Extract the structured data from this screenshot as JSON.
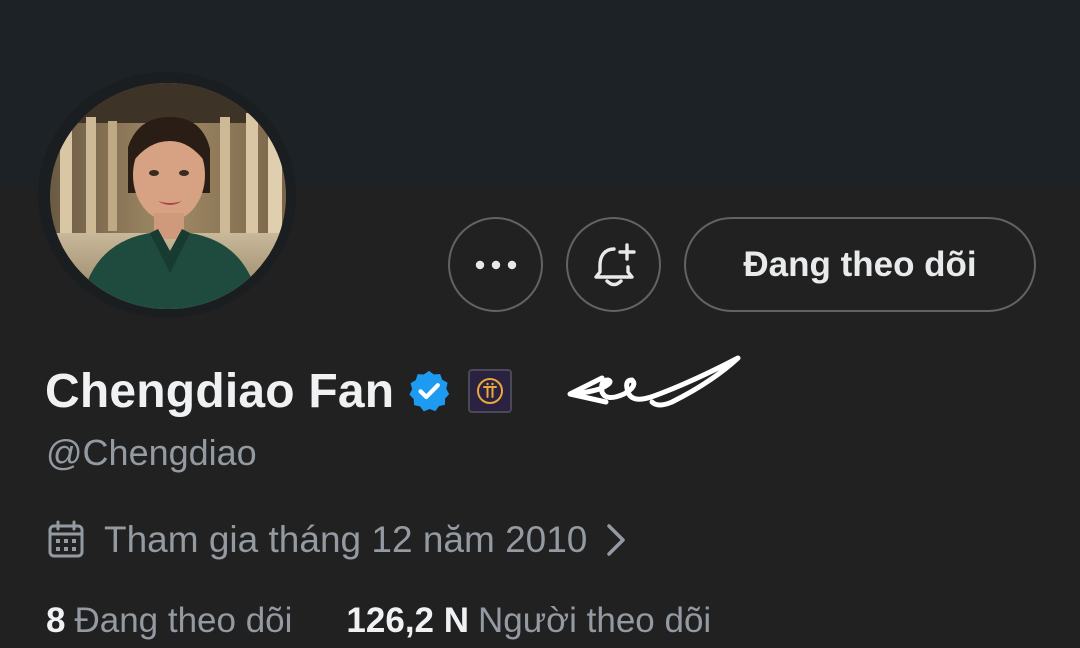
{
  "profile": {
    "display_name": "Chengdiao Fan",
    "handle": "@Chengdiao",
    "joined": "Tham gia tháng 12 năm 2010",
    "verified": true,
    "badge_icon": "pi-network-icon"
  },
  "actions": {
    "more_icon": "more-horizontal-icon",
    "notify_icon": "bell-plus-icon",
    "follow_label": "Đang theo dõi"
  },
  "stats": {
    "following_count": "8",
    "following_label": "Đang theo dõi",
    "followers_count": "126,2 N",
    "followers_label": "Người theo dõi"
  },
  "colors": {
    "banner": "#1c2226",
    "background": "#212121",
    "verified_blue": "#1d9bf0",
    "primary_text": "#eff1f3",
    "secondary_text": "#939aa1",
    "button_border": "#5f6468"
  }
}
